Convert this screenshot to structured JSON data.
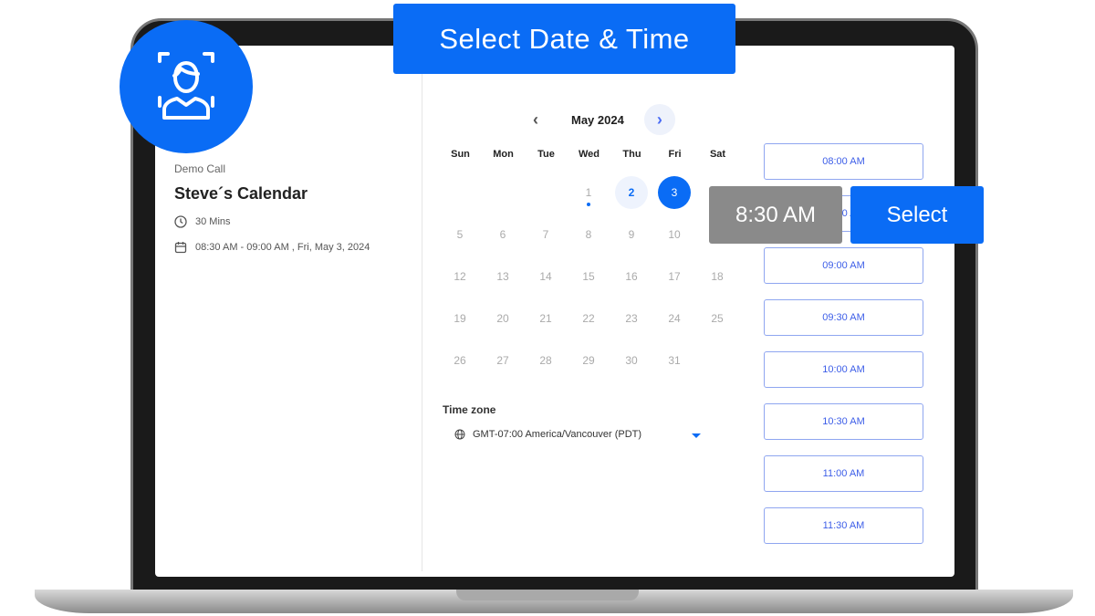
{
  "banner": "Select Date & Time",
  "event": {
    "type": "Demo Call",
    "title": "Steve´s Calendar",
    "duration": "30 Mins",
    "datetime": "08:30 AM - 09:00 AM , Fri, May 3, 2024"
  },
  "calendar": {
    "month": "May 2024",
    "weekdays": [
      "Sun",
      "Mon",
      "Tue",
      "Wed",
      "Thu",
      "Fri",
      "Sat"
    ],
    "weeks": [
      [
        "",
        "",
        "",
        "1",
        "2",
        "3",
        ""
      ],
      [
        "5",
        "6",
        "7",
        "8",
        "9",
        "10",
        ""
      ],
      [
        "12",
        "13",
        "14",
        "15",
        "16",
        "17",
        "18"
      ],
      [
        "19",
        "20",
        "21",
        "22",
        "23",
        "24",
        "25"
      ],
      [
        "26",
        "27",
        "28",
        "29",
        "30",
        "31",
        ""
      ]
    ],
    "today": "1",
    "available": [
      "2"
    ],
    "selected": "3"
  },
  "timezone": {
    "label": "Time zone",
    "value": "GMT-07:00 America/Vancouver (PDT)"
  },
  "slots": [
    "08:00 AM",
    "08:30 AM",
    "09:00 AM",
    "09:30 AM",
    "10:00 AM",
    "10:30 AM",
    "11:00 AM",
    "11:30 AM"
  ],
  "overlay": {
    "time": "8:30 AM",
    "select": "Select"
  },
  "colors": {
    "accent": "#0a6cf5",
    "selected_time_bg": "#8a8a8a"
  }
}
